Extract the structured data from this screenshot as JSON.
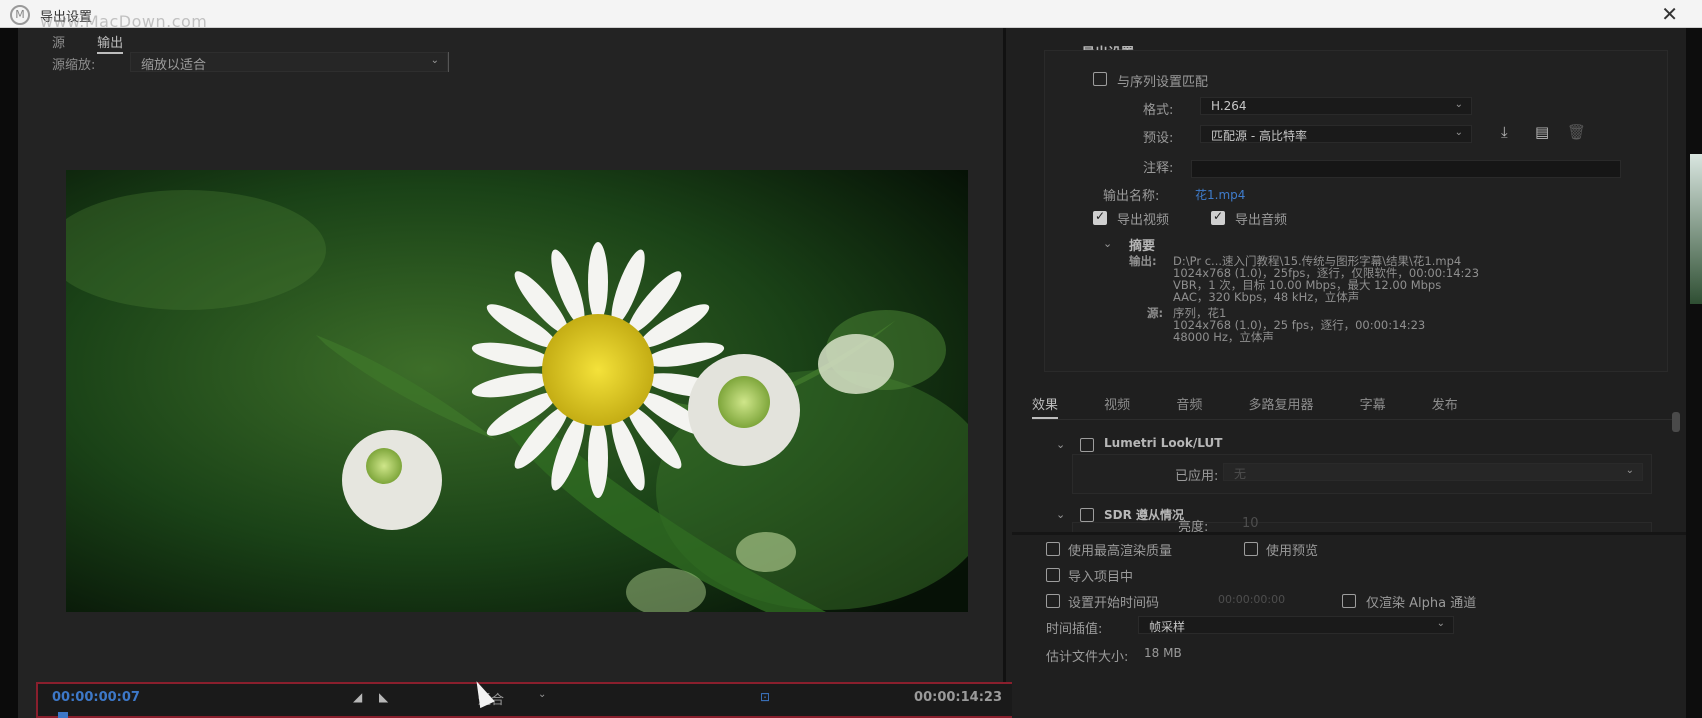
{
  "window": {
    "title": "导出设置",
    "watermark": "www.MacDown.com",
    "close_icon": "close-icon"
  },
  "left": {
    "tabs": [
      {
        "label": "源",
        "active": false
      },
      {
        "label": "输出",
        "active": true
      }
    ],
    "source_scaling": {
      "label": "源缩放:",
      "value": "缩放以适合"
    },
    "controls": {
      "current_timecode": "00:00:00:07",
      "duration_timecode": "00:00:14:23",
      "fit_value": "适合",
      "set_in_icon": "set-in-point-icon",
      "set_out_icon": "set-out-point-icon",
      "aspect_icon": "aspect-ratio-icon"
    },
    "preview_image": "daisy-flower-preview"
  },
  "right": {
    "export_settings": {
      "header": "导出设置",
      "match_sequence": {
        "label": "与序列设置匹配",
        "checked": false
      },
      "format": {
        "label": "格式:",
        "value": "H.264"
      },
      "preset": {
        "label": "预设:",
        "value": "匹配源 - 高比特率",
        "icons": [
          "import-preset-icon",
          "save-preset-icon",
          "delete-preset-icon"
        ]
      },
      "comment": {
        "label": "注释:",
        "value": ""
      },
      "output_name": {
        "label": "输出名称:",
        "value": "花1.mp4"
      },
      "export_video": {
        "label": "导出视频",
        "checked": true
      },
      "export_audio": {
        "label": "导出音频",
        "checked": true
      },
      "summary": {
        "header": "摘要",
        "output_label": "输出:",
        "output_lines": [
          "D:\\Pr c...速入门教程\\15.传统与图形字幕\\结果\\花1.mp4",
          "1024x768 (1.0)，25fps，逐行，仅限软件，00:00:14:23",
          "VBR，1 次，目标 10.00 Mbps，最大 12.00 Mbps",
          "AAC，320 Kbps，48 kHz，立体声"
        ],
        "source_label": "源:",
        "source_lines": [
          "序列，花1",
          "1024x768 (1.0)，25 fps，逐行，00:00:14:23",
          "48000 Hz，立体声"
        ]
      }
    },
    "tabs": [
      {
        "label": "效果",
        "active": true
      },
      {
        "label": "视频",
        "active": false
      },
      {
        "label": "音频",
        "active": false
      },
      {
        "label": "多路复用器",
        "active": false
      },
      {
        "label": "字幕",
        "active": false
      },
      {
        "label": "发布",
        "active": false
      }
    ],
    "effects": {
      "lumetri": {
        "label": "Lumetri Look/LUT",
        "applied_label": "已应用:",
        "applied_value": "无"
      },
      "sdr": {
        "label": "SDR 遵从情况",
        "brightness_label": "亮度:",
        "brightness_value": "10"
      }
    },
    "bottom": {
      "max_render_quality": "使用最高渲染质量",
      "use_previews": "使用预览",
      "import_into_project": "导入项目中",
      "set_start_timecode": "设置开始时间码",
      "start_timecode_value": "00:00:00:00",
      "render_alpha_only": "仅渲染 Alpha 通道",
      "time_interpolation_label": "时间插值:",
      "time_interpolation_value": "帧采样",
      "estimated_size_label": "估计文件大小:",
      "estimated_size_value": "18 MB"
    }
  }
}
